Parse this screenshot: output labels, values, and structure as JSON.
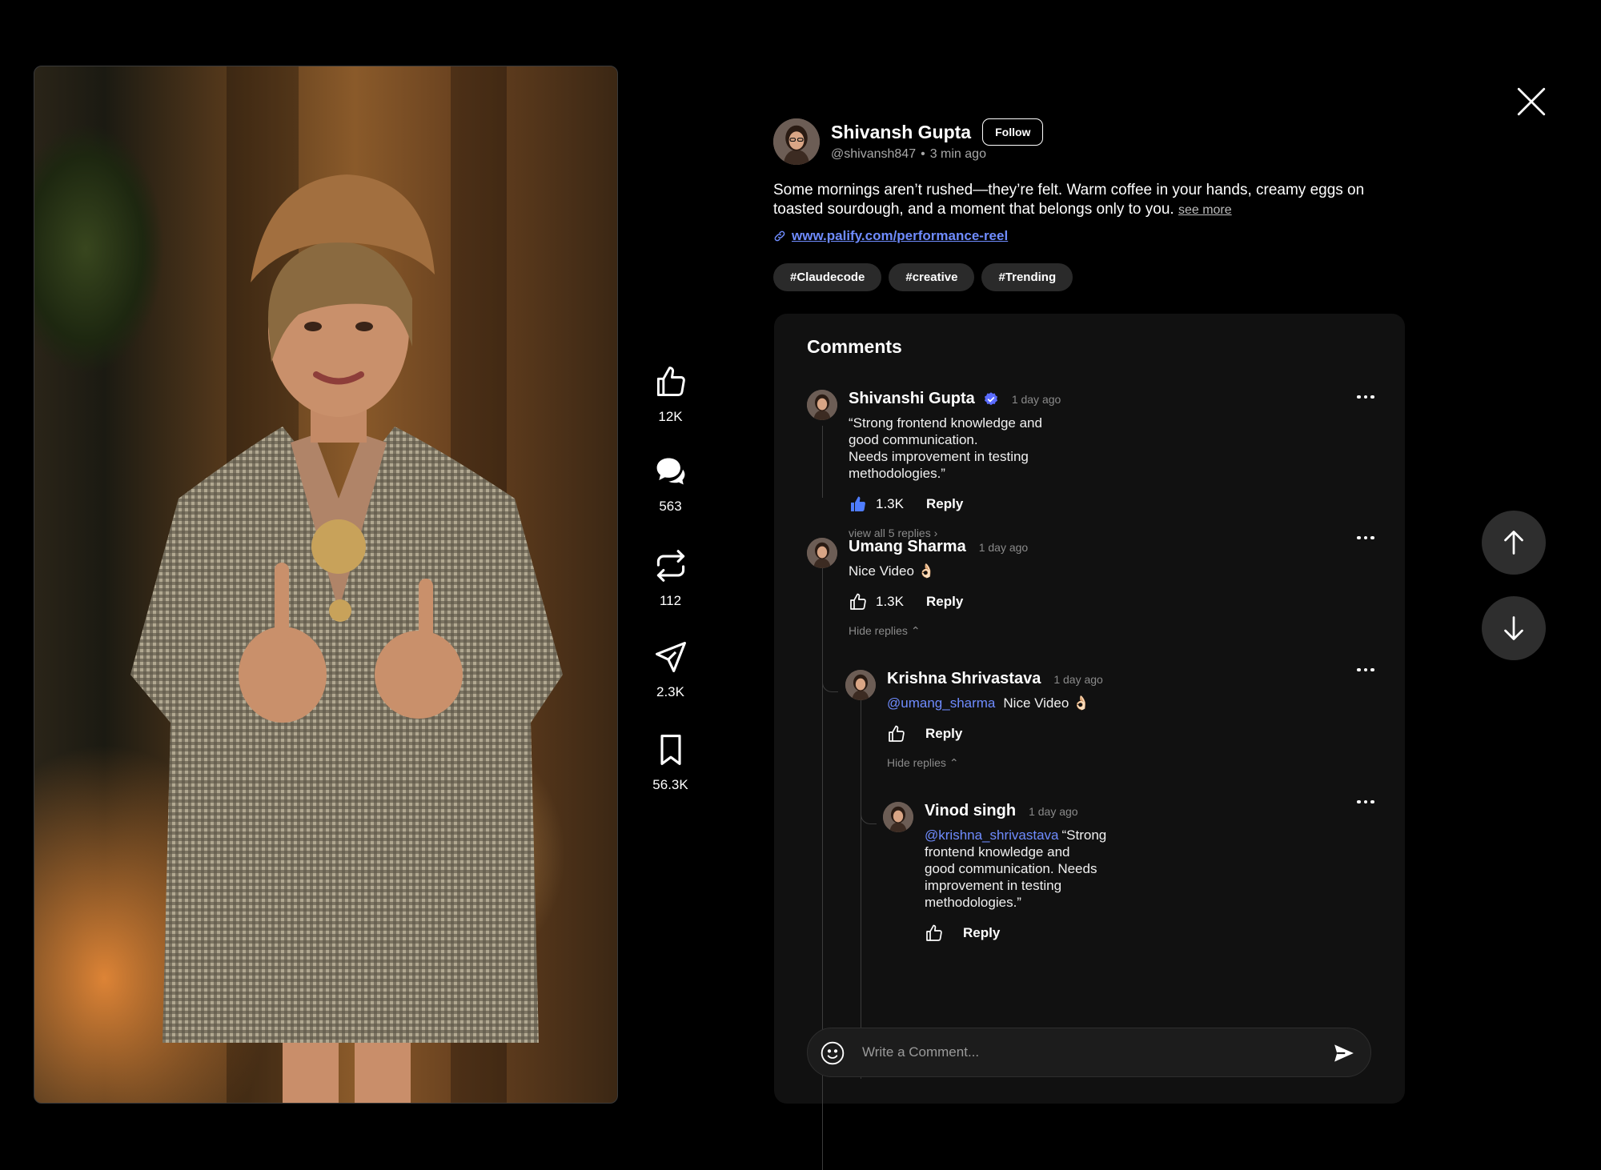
{
  "post": {
    "author_name": "Shivansh Gupta",
    "follow_label": "Follow",
    "handle": "@shivansh847",
    "dot": "•",
    "time": "3 min ago",
    "caption": "Some mornings aren’t rushed—they’re felt. Warm coffee in your hands, creamy eggs on toasted sourdough, and a moment that belongs only to you.",
    "see_more": "see more",
    "link": "www.palify.com/performance-reel",
    "tags": [
      "#Claudecode",
      "#creative",
      "#Trending"
    ]
  },
  "actions": {
    "likes": "12K",
    "comments": "563",
    "reposts": "112",
    "shares": "2.3K",
    "saves": "56.3K"
  },
  "comments": {
    "title": "Comments",
    "items": [
      {
        "name": "Shivanshi Gupta",
        "verified": true,
        "time": "1 day ago",
        "text": "“Strong frontend knowledge and good communication.\nNeeds improvement in testing methodologies.”",
        "likes": "1.3K",
        "liked": true,
        "reply": "Reply",
        "toggle": "view all 5 replies ›"
      },
      {
        "name": "Umang Sharma",
        "time": "1 day ago",
        "text": "Nice Video 👌🏻",
        "likes": "1.3K",
        "reply": "Reply",
        "toggle": "Hide replies ⌃"
      },
      {
        "name": "Krishna Shrivastava",
        "time": "1 day ago",
        "mention": "@umang_sharma",
        "text": "Nice Video 👌🏻",
        "reply": "Reply",
        "toggle": "Hide replies ⌃"
      },
      {
        "name": "Vinod singh",
        "time": "1 day ago",
        "mention": "@krishna_shrivastava",
        "text": "“Strong frontend knowledge and\ngood communication. Needs improvement in testing\nmethodologies.”",
        "reply": "Reply"
      }
    ],
    "composer_placeholder": "Write a Comment..."
  },
  "icons": {
    "like": "thumbs-up-icon",
    "comment": "chat-bubbles-icon",
    "repost": "repeat-icon",
    "share": "paper-plane-icon",
    "save": "bookmark-icon",
    "close": "close-icon",
    "prev": "arrow-up-icon",
    "next": "arrow-down-icon",
    "verified": "verified-badge-icon",
    "link": "link-icon",
    "emoji": "smiley-icon",
    "send": "send-icon",
    "more": "more-dots-icon"
  },
  "colors": {
    "background": "#000000",
    "panel": "#111111",
    "accent": "#6f8cff",
    "verified": "#5b6cff",
    "liked": "#4f7dff"
  }
}
